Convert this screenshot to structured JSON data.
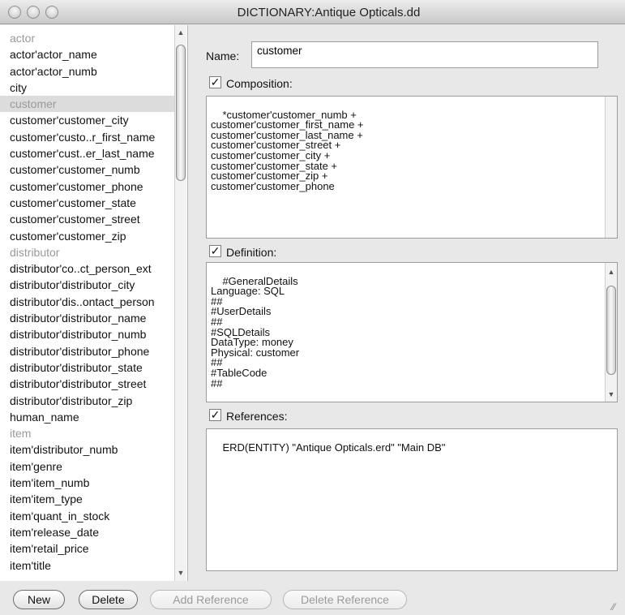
{
  "window": {
    "title": "DICTIONARY:Antique Opticals.dd"
  },
  "list": {
    "items": [
      {
        "label": "actor",
        "style": "gray"
      },
      {
        "label": "actor'actor_name",
        "style": ""
      },
      {
        "label": "actor'actor_numb",
        "style": ""
      },
      {
        "label": "city",
        "style": ""
      },
      {
        "label": "customer",
        "style": "sel"
      },
      {
        "label": "customer'customer_city",
        "style": ""
      },
      {
        "label": "customer'custo..r_first_name",
        "style": ""
      },
      {
        "label": "customer'cust..er_last_name",
        "style": ""
      },
      {
        "label": "customer'customer_numb",
        "style": ""
      },
      {
        "label": "customer'customer_phone",
        "style": ""
      },
      {
        "label": "customer'customer_state",
        "style": ""
      },
      {
        "label": "customer'customer_street",
        "style": ""
      },
      {
        "label": "customer'customer_zip",
        "style": ""
      },
      {
        "label": "distributor",
        "style": "gray"
      },
      {
        "label": "distributor'co..ct_person_ext",
        "style": ""
      },
      {
        "label": "distributor'distributor_city",
        "style": ""
      },
      {
        "label": "distributor'dis..ontact_person",
        "style": ""
      },
      {
        "label": "distributor'distributor_name",
        "style": ""
      },
      {
        "label": "distributor'distributor_numb",
        "style": ""
      },
      {
        "label": "distributor'distributor_phone",
        "style": ""
      },
      {
        "label": "distributor'distributor_state",
        "style": ""
      },
      {
        "label": "distributor'distributor_street",
        "style": ""
      },
      {
        "label": "distributor'distributor_zip",
        "style": ""
      },
      {
        "label": "human_name",
        "style": ""
      },
      {
        "label": "item",
        "style": "gray"
      },
      {
        "label": "item'distributor_numb",
        "style": ""
      },
      {
        "label": "item'genre",
        "style": ""
      },
      {
        "label": "item'item_numb",
        "style": ""
      },
      {
        "label": "item'item_type",
        "style": ""
      },
      {
        "label": "item'quant_in_stock",
        "style": ""
      },
      {
        "label": "item'release_date",
        "style": ""
      },
      {
        "label": "item'retail_price",
        "style": ""
      },
      {
        "label": "item'title",
        "style": ""
      }
    ]
  },
  "detail": {
    "name_label": "Name:",
    "name_value": "customer",
    "composition_label": "Composition:",
    "composition_text": "*customer'customer_numb +\ncustomer'customer_first_name +\ncustomer'customer_last_name +\ncustomer'customer_street +\ncustomer'customer_city +\ncustomer'customer_state +\ncustomer'customer_zip +\ncustomer'customer_phone",
    "definition_label": "Definition:",
    "definition_text": "#GeneralDetails\nLanguage: SQL\n##\n#UserDetails\n##\n#SQLDetails\nDataType: money\nPhysical: customer\n##\n#TableCode\n##",
    "references_label": "References:",
    "references_text": "ERD(ENTITY) \"Antique Opticals.erd\" \"Main DB\"",
    "checkmark": "✓"
  },
  "buttons": {
    "new": "New",
    "delete": "Delete",
    "add_reference": "Add Reference",
    "delete_reference": "Delete Reference"
  }
}
